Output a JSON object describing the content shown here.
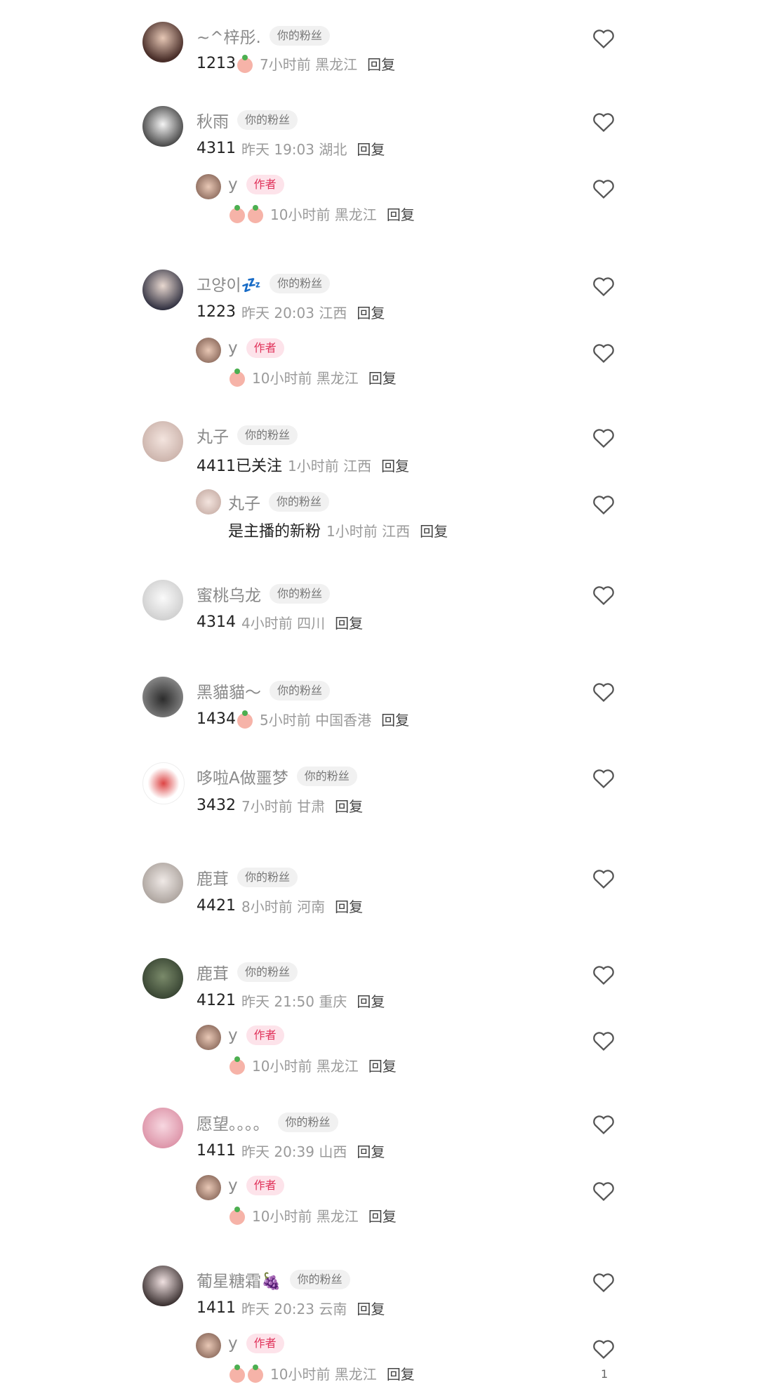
{
  "badges": {
    "fan": "你的粉丝",
    "author": "作者"
  },
  "reply_label": "回复",
  "colors": {
    "author_badge": "#e0325a",
    "text_gray": "#8a8a8a",
    "meta_gray": "#9a9a9a"
  },
  "comments": [
    {
      "name": "~^梓彤.",
      "content": "1213",
      "emoji": 1,
      "meta": "7小时前 黑龙江"
    },
    {
      "name": "秋雨",
      "content": "4311",
      "meta": "昨天 19:03 湖北",
      "reply": {
        "name": "y",
        "emoji": 2,
        "meta": "10小时前 黑龙江"
      }
    },
    {
      "name": "고양이💤",
      "content": "1223",
      "meta": "昨天 20:03 江西",
      "reply": {
        "name": "y",
        "emoji": 1,
        "meta": "10小时前 黑龙江"
      }
    },
    {
      "name": "丸子",
      "content": "4411已关注",
      "meta": "1小时前 江西",
      "reply": {
        "name": "丸子",
        "badge": "fan",
        "content": "是主播的新粉",
        "meta": "1小时前 江西"
      }
    },
    {
      "name": "蜜桃乌龙",
      "content": "4314",
      "meta": "4小时前 四川"
    },
    {
      "name": "黑貓貓～",
      "content": "1434",
      "emoji": 1,
      "meta": "5小时前 中国香港"
    },
    {
      "name": "哆啦A做噩梦",
      "content": "3432",
      "meta": "7小时前 甘肃"
    },
    {
      "name": "鹿茸",
      "content": "4421",
      "meta": "8小时前 河南"
    },
    {
      "name": "鹿茸",
      "content": "4121",
      "meta": "昨天 21:50 重庆",
      "reply": {
        "name": "y",
        "emoji": 1,
        "meta": "10小时前 黑龙江"
      }
    },
    {
      "name": "愿望。。。。",
      "content": "1411",
      "meta": "昨天 20:39 山西",
      "reply": {
        "name": "y",
        "emoji": 1,
        "meta": "10小时前 黑龙江"
      }
    },
    {
      "name": "葡星糖霜🍇",
      "content": "1411",
      "meta": "昨天 20:23 云南",
      "reply": {
        "name": "y",
        "emoji": 2,
        "meta": "10小时前 黑龙江",
        "likes": "1"
      }
    }
  ]
}
